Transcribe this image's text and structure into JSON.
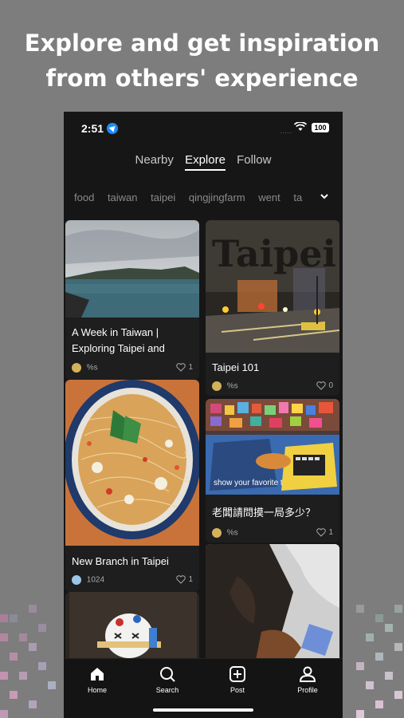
{
  "headline": "Explore and get inspiration from others' experience",
  "status_bar": {
    "time": "2:51",
    "battery": "100",
    "signal": "....."
  },
  "tabs": [
    {
      "label": "Nearby",
      "active": false
    },
    {
      "label": "Explore",
      "active": true
    },
    {
      "label": "Follow",
      "active": false
    }
  ],
  "tags": [
    "food",
    "taiwan",
    "taipei",
    "qingjingfarm",
    "went",
    "ta"
  ],
  "posts": {
    "left": [
      {
        "title_line1": "A Week in Taiwan |",
        "title_line2": "Exploring Taipei and",
        "user": "%s",
        "likes": "1",
        "image": "harbor-photo"
      },
      {
        "title_line1": "New Branch in Taipei",
        "user": "1024",
        "likes": "1",
        "image": "noodles-photo"
      },
      {
        "image": "dessert-photo"
      }
    ],
    "right": [
      {
        "title_line1": "Taipei 101",
        "user": "%s",
        "likes": "0",
        "image": "taipei-night-photo"
      },
      {
        "title_line1": "老闆請問摸一局多少？",
        "user": "%s",
        "likes": "1",
        "image": "claw-machine-photo",
        "overlay": "show your favorite t"
      },
      {
        "image": "cat-photo"
      }
    ]
  },
  "tabbar": [
    {
      "label": "Home",
      "icon": "home-icon"
    },
    {
      "label": "Search",
      "icon": "search-icon"
    },
    {
      "label": "Post",
      "icon": "plus-square-icon"
    },
    {
      "label": "Profile",
      "icon": "person-icon"
    }
  ],
  "colors": {
    "background": "#7d7d7d",
    "phone": "#161616",
    "accent": "#1a8cff"
  }
}
